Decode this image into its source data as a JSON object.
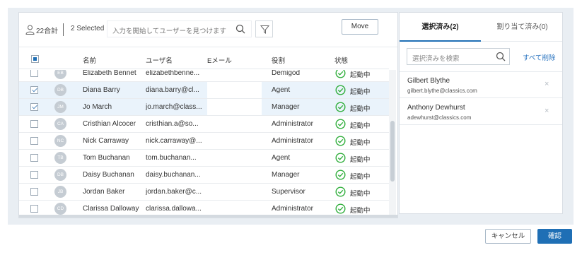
{
  "toolbar": {
    "total_label": "22合計",
    "selected_label": "2 Selected",
    "search_placeholder": "入力を開始してユーザーを見つけます",
    "move_label": "Move"
  },
  "columns": [
    "名前",
    "ユーザ名",
    "Eメール",
    "役割",
    "状態"
  ],
  "rows": [
    {
      "initials": "EB",
      "name": "Elizabeth Bennet",
      "username": "elizabethbenne...",
      "role": "Demigod",
      "status": "起動中",
      "selected": false
    },
    {
      "initials": "DB",
      "name": "Diana Barry",
      "username": "diana.barry@cl...",
      "role": "Agent",
      "status": "起動中",
      "selected": true
    },
    {
      "initials": "JM",
      "name": "Jo March",
      "username": "jo.march@class...",
      "role": "Manager",
      "status": "起動中",
      "selected": true
    },
    {
      "initials": "CA",
      "name": "Cristhian Alcocer",
      "username": "cristhian.a@so...",
      "role": "Administrator",
      "status": "起動中",
      "selected": false
    },
    {
      "initials": "NC",
      "name": "Nick Carraway",
      "username": "nick.carraway@...",
      "role": "Administrator",
      "status": "起動中",
      "selected": false
    },
    {
      "initials": "TB",
      "name": "Tom Buchanan",
      "username": "tom.buchanan...",
      "role": "Agent",
      "status": "起動中",
      "selected": false
    },
    {
      "initials": "DB",
      "name": "Daisy Buchanan",
      "username": "daisy.buchanan...",
      "role": "Manager",
      "status": "起動中",
      "selected": false
    },
    {
      "initials": "JB",
      "name": "Jordan Baker",
      "username": "jordan.baker@c...",
      "role": "Supervisor",
      "status": "起動中",
      "selected": false
    },
    {
      "initials": "CD",
      "name": "Clarissa Dalloway",
      "username": "clarissa.dallowa...",
      "role": "Administrator",
      "status": "起動中",
      "selected": false
    }
  ],
  "right_panel": {
    "tab_selected": "選択済み(2)",
    "tab_assigned": "割り当て済み(0)",
    "search_placeholder": "選択済みを検索",
    "clear_all": "すべて削除",
    "items": [
      {
        "name": "Gilbert Blythe",
        "email": "gilbert.blythe@classics.com"
      },
      {
        "name": "Anthony Dewhurst",
        "email": "adewhurst@classics.com"
      }
    ],
    "remove_glyph": "×"
  },
  "footer": {
    "cancel_label": "キャンセル",
    "confirm_label": "確認"
  },
  "colors": {
    "accent": "#1f6fb5",
    "status_green": "#2fae3b",
    "selected_row": "#eaf3fb",
    "backdrop": "#e9eef3"
  },
  "icons": {
    "user": "user-icon",
    "search": "search-icon",
    "filter": "filter-icon",
    "status": "check-circle-icon",
    "remove": "close-icon"
  }
}
